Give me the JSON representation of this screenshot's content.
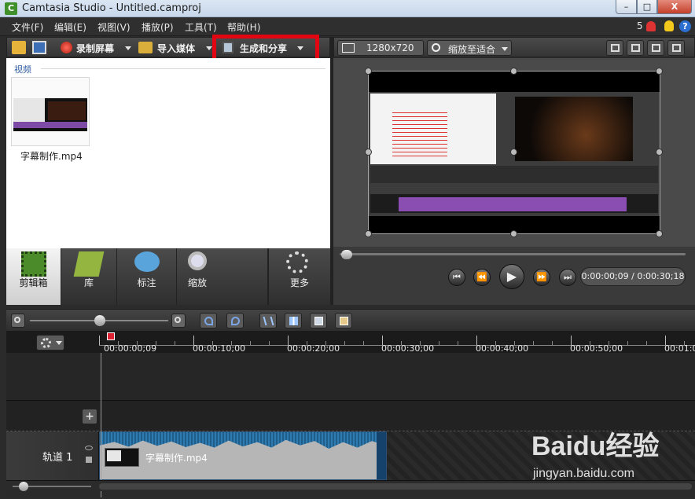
{
  "window": {
    "title": "Camtasia Studio - Untitled.camproj",
    "app_icon": "C",
    "controls": [
      "–",
      "□",
      "X"
    ]
  },
  "menu": {
    "items": [
      "文件(F)",
      "编辑(E)",
      "视图(V)",
      "播放(P)",
      "工具(T)",
      "帮助(H)"
    ],
    "notification_count": "5"
  },
  "toolbar": {
    "record_label": "录制屏幕",
    "import_label": "导入媒体",
    "produce_label": "生成和分享"
  },
  "clipbin": {
    "section_label": "视频",
    "clips": [
      {
        "name": "字幕制作.mp4"
      }
    ]
  },
  "tasks": [
    {
      "label": "剪辑箱",
      "icon": "film-icon",
      "active": true
    },
    {
      "label": "库",
      "icon": "library-icon",
      "active": false
    },
    {
      "label": "标注",
      "icon": "callout-icon",
      "active": false
    },
    {
      "label": "缩放",
      "icon": "zoom-icon",
      "active": false
    },
    {
      "label": "更多",
      "icon": "more-icon",
      "active": false
    }
  ],
  "preview": {
    "dimensions": "1280x720",
    "zoom_label": "缩放至适合",
    "time": "0:00:00;09 / 0:00:30;18"
  },
  "timeline": {
    "ticks": [
      "00:00:00;09",
      "00:00:10;00",
      "00:00:20;00",
      "00:00:30;00",
      "00:00:40;00",
      "00:00:50;00",
      "00:01:0"
    ],
    "track_label": "轨道 1",
    "clip_label": "字幕制作.mp4",
    "add_track": "+"
  },
  "watermark": {
    "main": "Baidu经验",
    "sub": "jingyan.baidu.com"
  },
  "colors": {
    "highlight": "#e20613",
    "accent": "#2d5aa0",
    "clip_audio": "#1f5e8a"
  }
}
